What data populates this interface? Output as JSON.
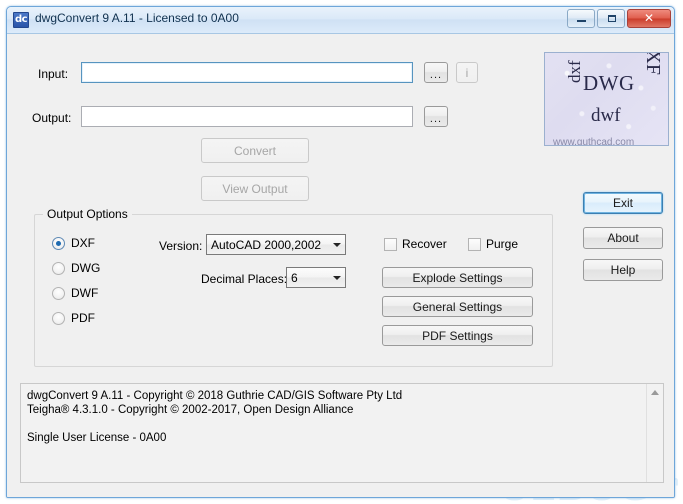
{
  "window": {
    "title": "dwgConvert 9 A.11 - Licensed to 0A00",
    "icon_text": "dc",
    "icon_name": "app-icon-dc",
    "controls": {
      "minimize": "minimize-icon",
      "maximize": "maximize-icon",
      "close": "✕"
    }
  },
  "form": {
    "input_label": "Input:",
    "input_value": "",
    "input_placeholder": "",
    "output_label": "Output:",
    "output_value": "",
    "output_placeholder": "",
    "browse_label": "...",
    "info_label": "i",
    "convert_label": "Convert",
    "view_output_label": "View Output"
  },
  "output_options": {
    "title": "Output Options",
    "formats": [
      {
        "label": "DXF",
        "selected": true
      },
      {
        "label": "DWG",
        "selected": false
      },
      {
        "label": "DWF",
        "selected": false
      },
      {
        "label": "PDF",
        "selected": false
      }
    ],
    "version_label": "Version:",
    "version_value": "AutoCAD 2000,2002",
    "decimal_places_label": "Decimal Places:",
    "decimal_places_value": "6",
    "recover_label": "Recover",
    "recover_checked": false,
    "purge_label": "Purge",
    "purge_checked": false,
    "explode_settings_label": "Explode Settings",
    "general_settings_label": "General Settings",
    "pdf_settings_label": "PDF Settings"
  },
  "side_buttons": {
    "exit_label": "Exit",
    "about_label": "About",
    "help_label": "Help"
  },
  "logo": {
    "dwg": "DWG",
    "dxf": "DXF",
    "dxf_rotated": "dxf",
    "dwf": "dwf",
    "url": "www.guthcad.com"
  },
  "log": {
    "lines": "dwgConvert 9 A.11 - Copyright © 2018 Guthrie CAD/GIS Software Pty Ltd\nTeigha® 4.3.1.0 - Copyright © 2002-2017, Open Design Alliance\n\nSingle User License - 0A00"
  },
  "watermark": {
    "main": "UEBUG",
    "suffix": "com"
  },
  "colors": {
    "accent": "#3c7fb1",
    "window_bg": "#f0f0f0",
    "titlebar": "#dbe9f8",
    "close_red": "#cb3c2b",
    "radio_dot": "#1d6ab0"
  }
}
